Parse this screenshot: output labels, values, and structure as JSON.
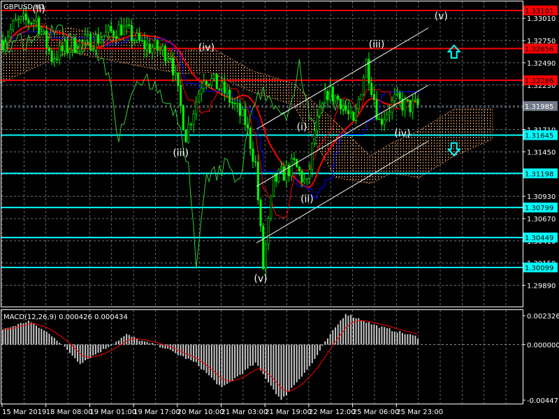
{
  "window": {
    "title": "GBPUSD,H1"
  },
  "colors": {
    "bg": "#000000",
    "grid": "#8a97a8",
    "candle": "#00ff00",
    "resistance": "#ff0000",
    "support": "#00ffff",
    "current": "#707a88",
    "kijun": "#0000ff",
    "ma": "#ff0000",
    "chikou": "#32cd32",
    "cloud": "#f4a460",
    "cloud2": "#ffdab9",
    "channel": "#ffffff"
  },
  "chart_data": {
    "type": "candlestick",
    "symbol": "GBPUSD",
    "timeframe": "H1",
    "price_ticks": [
      "1.33010",
      "1.32750",
      "1.32490",
      "1.32230",
      "1.31970",
      "1.31710",
      "1.31450",
      "1.31190",
      "1.30930",
      "1.30670",
      "1.30410",
      "1.30150",
      "1.29890"
    ],
    "time_labels": [
      "15 Mar 2019",
      "18 Mar 08:00",
      "19 Mar 01:00",
      "19 Mar 17:00",
      "20 Mar 10:00",
      "21 Mar 03:00",
      "21 Mar 19:00",
      "22 Mar 12:00",
      "25 Mar 06:00",
      "25 Mar 23:00"
    ],
    "current_price": {
      "label": "1.31985",
      "value": 1.31985
    },
    "resistance_levels": [
      {
        "label": "1.33101",
        "value": 1.33101
      },
      {
        "label": "1.32656",
        "value": 1.32656
      },
      {
        "label": "1.32286",
        "value": 1.32286
      }
    ],
    "support_levels": [
      {
        "label": "1.31645",
        "value": 1.31645
      },
      {
        "label": "1.31198",
        "value": 1.31198
      },
      {
        "label": "1.30799",
        "value": 1.30799
      },
      {
        "label": "1.30449",
        "value": 1.30449
      },
      {
        "label": "1.30099",
        "value": 1.30099
      }
    ],
    "price_path_bars": [
      0,
      5,
      13,
      19,
      27,
      35,
      46,
      54,
      65,
      71,
      78,
      86,
      94,
      98,
      101,
      105,
      113,
      118,
      121,
      126,
      131,
      136,
      141,
      146,
      152,
      157,
      161
    ],
    "price_path_values": [
      1.3275,
      1.3295,
      1.33,
      1.3255,
      1.327,
      1.3275,
      1.329,
      1.327,
      1.326,
      1.3165,
      1.3235,
      1.3215,
      1.318,
      1.313,
      1.301,
      1.311,
      1.313,
      1.3105,
      1.317,
      1.3215,
      1.3205,
      1.3175,
      1.325,
      1.318,
      1.3205,
      1.3198,
      1.31985
    ],
    "wave_labels": [
      {
        "text": "(ii)",
        "bar": 14,
        "price": 1.3308
      },
      {
        "text": "(iv)",
        "bar": 79,
        "price": 1.3263
      },
      {
        "text": "(iii)",
        "bar": 69,
        "price": 1.314
      },
      {
        "text": "(v)",
        "bar": 100,
        "price": 1.2993
      },
      {
        "text": "(i)",
        "bar": 116,
        "price": 1.317
      },
      {
        "text": "(ii)",
        "bar": 118,
        "price": 1.3086
      },
      {
        "text": "(iii)",
        "bar": 145,
        "price": 1.3267
      },
      {
        "text": "(iv)",
        "bar": 155,
        "price": 1.3163
      },
      {
        "text": "(v)",
        "bar": 170,
        "price": 1.33
      }
    ],
    "arrows": [
      {
        "direction": "up",
        "bar": 175,
        "price": 1.3262
      },
      {
        "direction": "down",
        "bar": 175,
        "price": 1.3148
      }
    ]
  },
  "macd": {
    "label": "MACD(12,26,9) 0.000426 0.000434",
    "ticks": [
      "0.002326",
      "0.000000",
      "-0.004471"
    ],
    "max": 0.002326,
    "min": -0.004471,
    "hist_bars": [
      0,
      10,
      20,
      30,
      40,
      48,
      55,
      62,
      75,
      85,
      98,
      108,
      120,
      126,
      133,
      145,
      161
    ],
    "hist_values": [
      0.0012,
      0.0019,
      0.0006,
      -0.0015,
      -0.0003,
      0.0008,
      0.0002,
      -0.0002,
      -0.0015,
      -0.0035,
      -0.0015,
      -0.0045,
      -0.0015,
      0.0005,
      0.0025,
      0.0015,
      0.0006
    ]
  }
}
